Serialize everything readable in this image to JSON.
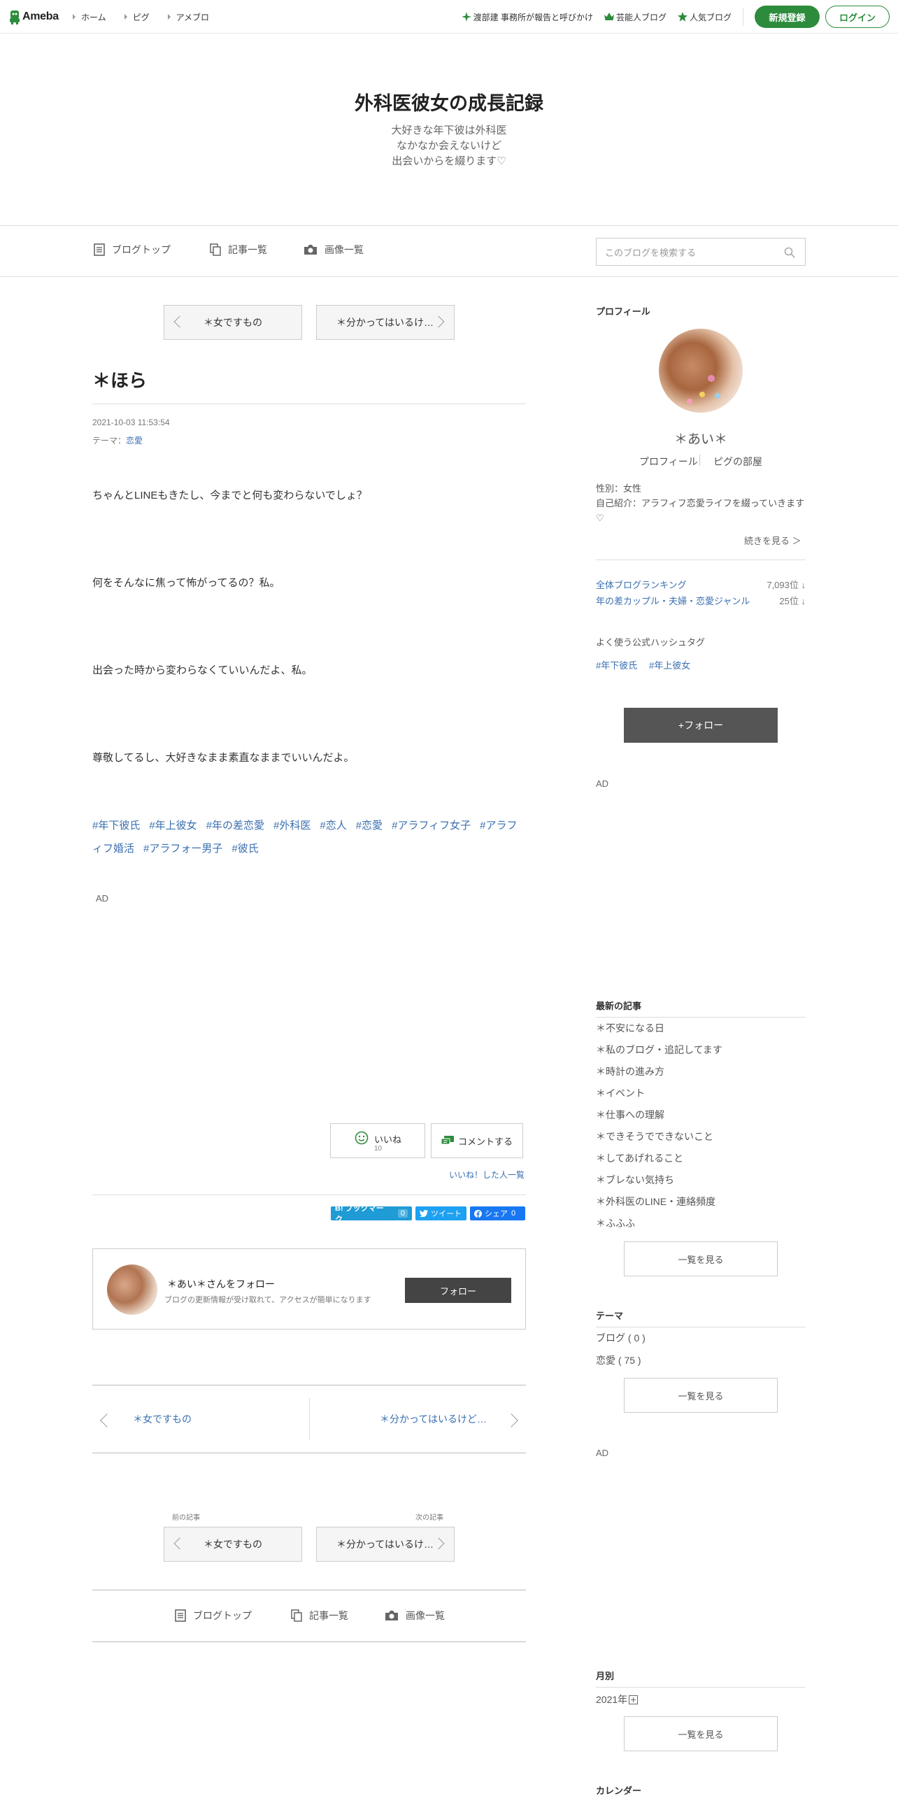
{
  "topbar": {
    "logo": "Ameba",
    "nav": [
      "ホーム",
      "ピグ",
      "アメブロ"
    ],
    "links": [
      "渡部建 事務所が報告と呼びかけ",
      "芸能人ブログ",
      "人気ブログ"
    ],
    "register": "新規登録",
    "login": "ログイン"
  },
  "header": {
    "title": "外科医彼女の成長記録",
    "desc": [
      "大好きな年下彼は外科医",
      "なかなか会えないけど",
      "出会いからを綴ります♡"
    ]
  },
  "blognav": {
    "items": [
      "ブログトップ",
      "記事一覧",
      "画像一覧"
    ],
    "search_placeholder": "このブログを検索する"
  },
  "pager": {
    "prev": "＊女ですもの",
    "next": "＊分かってはいるけど…",
    "prev_label": "前の記事",
    "next_label": "次の記事"
  },
  "entry": {
    "title": "＊ほら",
    "date": "2021-10-03 11:53:54",
    "theme_label": "テーマ：",
    "theme": "恋愛",
    "paragraphs": [
      "ちゃんとLINEもきたし、今までと何も変わらないでしょ？",
      "何をそんなに焦って怖がってるの？私。",
      "出会った時から変わらなくていいんだよ、私。",
      "尊敬してるし、大好きなまま素直なままでいいんだよ。"
    ],
    "tags": [
      "#年下彼氏",
      "#年上彼女",
      "#年の差恋愛",
      "#外科医",
      "#恋人",
      "#恋愛",
      "#アラフィフ女子",
      "#アラフィフ婚活",
      "#アラフォー男子",
      "#彼氏"
    ],
    "ad": "AD"
  },
  "actions": {
    "iine": "いいね",
    "iine_count": "10",
    "comment": "コメントする",
    "iine_list": "いいね！した人一覧",
    "hatena": "B! ブックマーク",
    "hatena_count": "0",
    "tweet": "ツイート",
    "share": "シェア",
    "share_count": "0"
  },
  "followcard": {
    "name": "＊あい＊さんをフォロー",
    "desc": "ブログの更新情報が受け取れて、アクセスが簡単になります",
    "button": "フォロー"
  },
  "sidebar": {
    "profile_heading": "プロフィール",
    "name": "＊あい＊",
    "profile_link": "プロフィール",
    "pig_link": "ピグの部屋",
    "gender": "性別：女性",
    "intro": "自己紹介：アラフィフ恋愛ライフを綴っていきます♡",
    "more": "続きを見る ＞",
    "rankings": [
      {
        "label": "全体ブログランキング",
        "value": "7,093位 ↓"
      },
      {
        "label": "年の差カップル・夫婦・恋愛ジャンル",
        "value": "25位 ↓"
      }
    ],
    "hashtag_heading": "よく使う公式ハッシュタグ",
    "hashtags": [
      "#年下彼氏",
      "#年上彼女"
    ],
    "follow_button": "+フォロー",
    "ad": "AD",
    "recent_heading": "最新の記事",
    "recent": [
      "＊不安になる日",
      "＊私のブログ・追記してます",
      "＊時計の進み方",
      "＊イベント",
      "＊仕事への理解",
      "＊できそうでできないこと",
      "＊してあげれること",
      "＊ブレない気持ち",
      "＊外科医のLINE・連絡頻度",
      "＊ふふふ"
    ],
    "list_more": "一覧を見る",
    "theme_heading": "テーマ",
    "themes": [
      "ブログ ( 0 )",
      "恋愛 ( 75 )"
    ],
    "ad2": "AD",
    "monthly_heading": "月別",
    "year": "2021年",
    "calendar_heading": "カレンダー"
  },
  "colors": {
    "brand_green": "#2d8c3c",
    "link_blue": "#3a6fb0",
    "dark_button": "#444444",
    "hatena": "#1f9bd6",
    "twitter": "#1da1f2",
    "facebook": "#1877f2"
  }
}
